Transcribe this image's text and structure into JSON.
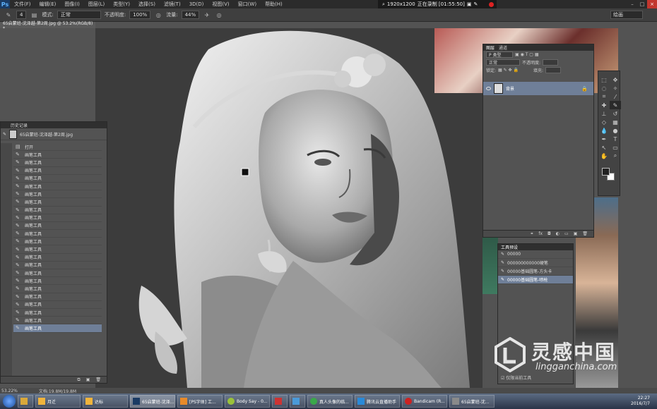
{
  "menubar": {
    "logo": "Ps",
    "items": [
      "文件(F)",
      "编辑(E)",
      "图像(I)",
      "图层(L)",
      "类型(Y)",
      "选择(S)",
      "滤镜(T)",
      "3D(D)",
      "视图(V)",
      "窗口(W)",
      "帮助(H)"
    ],
    "recording": "1920x1200",
    "recording_status": "正在录制 [01:55:50]"
  },
  "options": {
    "brush_size": "4",
    "mode_label": "模式:",
    "mode_value": "正常",
    "opacity_label": "不透明度:",
    "opacity_value": "100%",
    "flow_label": "流量:",
    "flow_value": "44%",
    "workspace": "绘画"
  },
  "document_tab": "65启蒙班-沈泽越-第2周.jpg @ 53.2%(RGB/8) *",
  "layers_panel": {
    "tabs": [
      "图层",
      "通道"
    ],
    "kind_filter": "P 类型",
    "blend_mode": "正常",
    "opacity_label": "不透明度:",
    "lock_label": "锁定:",
    "fill_label": "填充:",
    "layer_name": "背景"
  },
  "history_panel": {
    "title": "历史记录",
    "snapshot_name": "65启蒙班-沈泽越-第2周.jpg",
    "open_item": "打开",
    "items": [
      "画笔工具",
      "画笔工具",
      "画笔工具",
      "画笔工具",
      "画笔工具",
      "画笔工具",
      "画笔工具",
      "画笔工具",
      "画笔工具",
      "画笔工具",
      "画笔工具",
      "画笔工具",
      "画笔工具",
      "画笔工具",
      "画笔工具",
      "画笔工具",
      "画笔工具",
      "画笔工具",
      "画笔工具",
      "画笔工具",
      "画笔工具",
      "画笔工具",
      "画笔工具"
    ]
  },
  "presets_panel": {
    "title": "工具预设",
    "items": [
      "00000",
      "000000000000硬笔",
      "00000基础圆笔-方头卡",
      "00000基础圆笔-喷枪"
    ],
    "current_tool_only": "仅限当前工具"
  },
  "status": {
    "zoom": "53.22%",
    "doc_size": "文档:19.8M/19.8M"
  },
  "taskbar": {
    "buttons": [
      "月迁",
      "达标",
      "65启蒙班-沈泽...",
      "[PS字体] 工...",
      "Body Say - 0...",
      "",
      "",
      "真人头像的临...",
      "腾讯云直播助手",
      "Bandicam (R...",
      "65启蒙班-沈..."
    ],
    "time": "22:27",
    "date": "2016/7/7"
  },
  "watermark": {
    "cn": "灵感中国",
    "en": "lingganchina.com"
  },
  "colors": {
    "selection": "#6f7f98",
    "panel": "#535353",
    "canvas": "#3c3c3c"
  }
}
